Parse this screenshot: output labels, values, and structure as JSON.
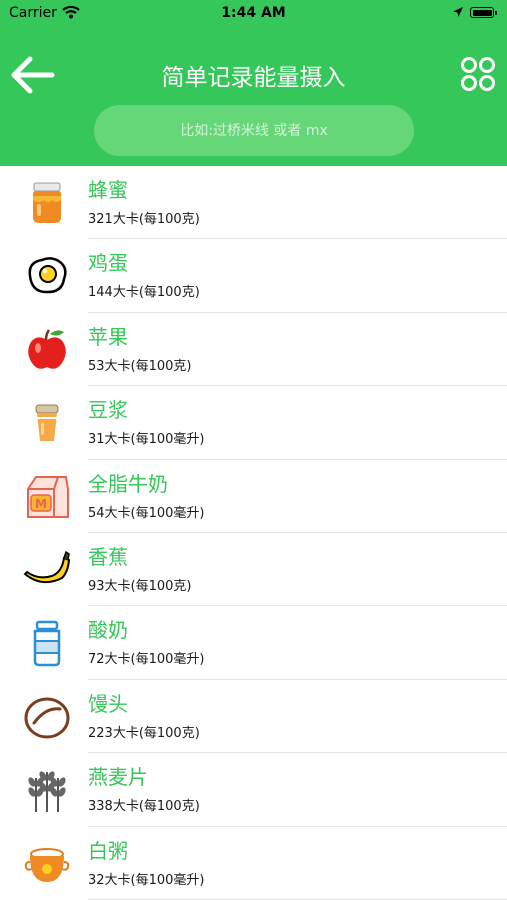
{
  "status": {
    "carrier": "Carrier",
    "time": "1:44 AM"
  },
  "header": {
    "title": "简单记录能量摄入"
  },
  "search": {
    "placeholder": "比如:过桥米线 或者 mx"
  },
  "foods": [
    {
      "name": "蜂蜜",
      "calories": "321大卡(每100克)",
      "icon": "honey-jar-icon"
    },
    {
      "name": "鸡蛋",
      "calories": "144大卡(每100克)",
      "icon": "fried-egg-icon"
    },
    {
      "name": "苹果",
      "calories": "53大卡(每100克)",
      "icon": "apple-icon"
    },
    {
      "name": "豆浆",
      "calories": "31大卡(每100毫升)",
      "icon": "soy-milk-cup-icon"
    },
    {
      "name": "全脂牛奶",
      "calories": "54大卡(每100毫升)",
      "icon": "milk-carton-icon"
    },
    {
      "name": "香蕉",
      "calories": "93大卡(每100克)",
      "icon": "banana-icon"
    },
    {
      "name": "酸奶",
      "calories": "72大卡(每100毫升)",
      "icon": "yogurt-bottle-icon"
    },
    {
      "name": "馒头",
      "calories": "223大卡(每100克)",
      "icon": "steamed-bun-icon"
    },
    {
      "name": "燕麦片",
      "calories": "338大卡(每100克)",
      "icon": "oat-icon"
    },
    {
      "name": "白粥",
      "calories": "32大卡(每100毫升)",
      "icon": "porridge-pot-icon"
    }
  ],
  "colors": {
    "brand": "#35c759",
    "search_bg": "#66d779"
  }
}
